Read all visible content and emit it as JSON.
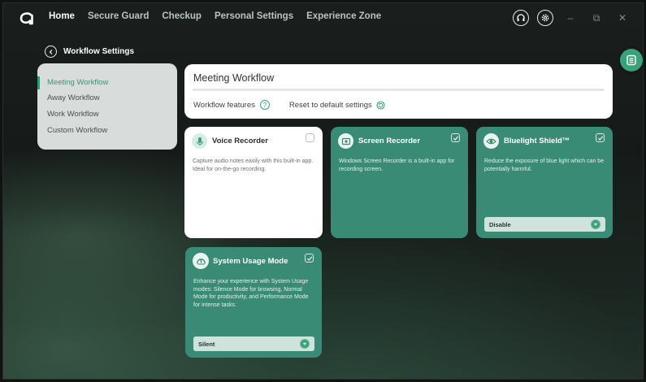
{
  "nav": {
    "items": [
      "Home",
      "Secure Guard",
      "Checkup",
      "Personal Settings",
      "Experience Zone"
    ],
    "active_index": 0
  },
  "icons": {
    "logo": "acer-logo-icon",
    "support": "headset-icon",
    "settings": "gear-icon",
    "minimize": "minimize-icon",
    "restore": "restore-icon",
    "close": "close-icon",
    "back": "chevron-left-icon",
    "panel": "list-panel-icon"
  },
  "window": {
    "minimize": "–",
    "restore": "⧉",
    "close": "✕"
  },
  "page": {
    "back_label": "Workflow Settings"
  },
  "sidebar": {
    "items": [
      {
        "label": "Meeting Workflow",
        "active": true
      },
      {
        "label": "Away Workflow",
        "active": false
      },
      {
        "label": "Work Workflow",
        "active": false
      },
      {
        "label": "Custom Workflow",
        "active": false
      }
    ]
  },
  "header": {
    "title": "Meeting Workflow",
    "features_label": "Workflow features",
    "reset_label": "Reset to default settings"
  },
  "cards": [
    {
      "title": "Voice Recorder",
      "desc": "Capture audio notes easily with this built-in app. Ideal for on-the-go recording.",
      "checked": false,
      "icon": "microphone-icon"
    },
    {
      "title": "Screen Recorder",
      "desc": "Windows Screen Recorder is a built-in app for recording screen.",
      "checked": true,
      "icon": "screen-record-icon"
    },
    {
      "title": "Bluelight Shield™",
      "desc": "Reduce the exposure of blue light which can be potentially harmful.",
      "checked": true,
      "icon": "eye-icon",
      "dropdown": "Disable"
    },
    {
      "title": "System Usage Mode",
      "desc": "Enhance your experience with System Usage modes: Silence Mode for browsing, Normal Mode for productivity, and Performance Mode for intense tasks.",
      "checked": true,
      "icon": "speedometer-icon",
      "dropdown": "Silent"
    }
  ],
  "colors": {
    "accent": "#3aa27a",
    "card_teal": "#3a8b76",
    "sidebar_bg": "#d8dcda"
  }
}
